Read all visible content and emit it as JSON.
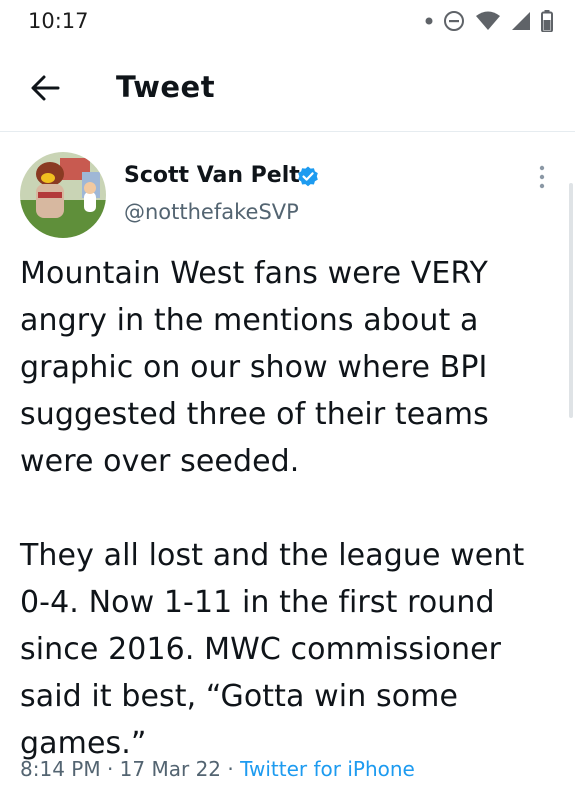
{
  "status_bar": {
    "time": "10:17",
    "icons": [
      "notification-dot-icon",
      "do-not-disturb-icon",
      "wifi-icon",
      "cellular-signal-icon",
      "battery-icon"
    ]
  },
  "header": {
    "title": "Tweet",
    "back_icon": "arrow-left-icon"
  },
  "tweet": {
    "author": {
      "name": "Scott Van Pelt",
      "handle": "@notthefakeSVP",
      "verified": true
    },
    "paragraphs": [
      "Mountain West fans were VERY angry in the mentions about a graphic on our show where BPI suggested three of their teams were over seeded.",
      "They all lost and the league went 0-4. Now 1-11 in the first round since 2016. MWC commissioner said it best, “Gotta win some games.”"
    ],
    "meta": {
      "time": "8:14 PM",
      "separator": " · ",
      "date": "17 Mar 22",
      "source": "Twitter for iPhone"
    }
  },
  "colors": {
    "accent": "#1d9bf0",
    "text_primary": "#0f1419",
    "text_secondary": "#536471"
  }
}
